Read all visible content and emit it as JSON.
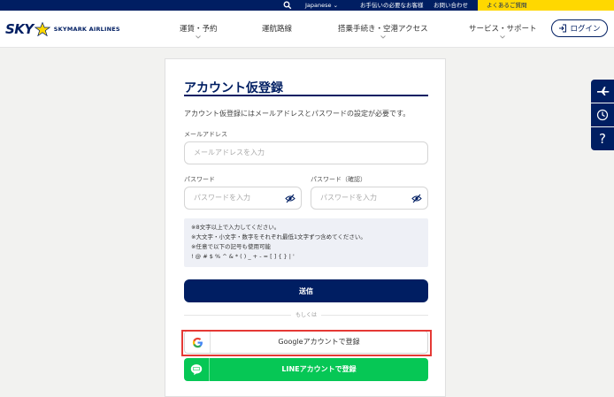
{
  "topbar": {
    "language": "Japanese ⌄",
    "link1": "お手伝いの必要なお客様",
    "link2": "お問い合わせ",
    "link3": "よくあるご質問"
  },
  "header": {
    "logo_text": "SKY",
    "brand_text": "SKYMARK AIRLINES",
    "nav": [
      "運賃・予約",
      "運航路線",
      "搭乗手続き・空港アクセス",
      "サービス・サポート"
    ],
    "login_label": "ログイン"
  },
  "form": {
    "title": "アカウント仮登録",
    "description": "アカウント仮登録にはメールアドレスとパスワードの設定が必要です。",
    "email_label": "メールアドレス",
    "email_placeholder": "メールアドレスを入力",
    "password_label": "パスワード",
    "password_placeholder": "パスワードを入力",
    "confirm_label": "パスワード（確認）",
    "confirm_placeholder": "パスワードを入力",
    "rules": [
      "※8文字以上で入力してください。",
      "※大文字・小文字・数字をそれぞれ最低1文字ずつ含めてください。",
      "※任意で以下の記号も使用可能",
      "! @ # $ % ^ & * ( ) _ + - = [ ] { } | '"
    ],
    "submit_label": "送信",
    "or_label": "もしくは",
    "google_label": "Googleアカウントで登録",
    "line_label": "LINEアカウントで登録"
  },
  "side": {
    "help_label": "?"
  },
  "colors": {
    "navy": "#001e62",
    "yellow": "#ffd800",
    "line_green": "#06c755",
    "highlight": "#e53935"
  }
}
